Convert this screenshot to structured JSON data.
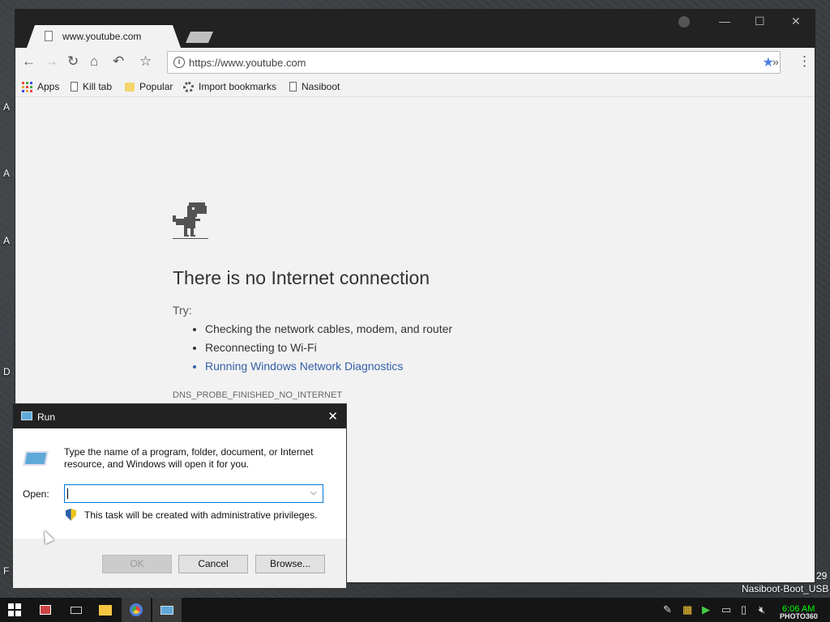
{
  "desktop": {
    "machine_name": "Nasiboot-Boot_USB",
    "partial_number": "29",
    "watermark": "PHOTO360"
  },
  "browser": {
    "tab_title": "www.youtube.com",
    "url": "https://www.youtube.com",
    "bookmarks": [
      {
        "label": "Apps",
        "icon": "apps-grid-icon"
      },
      {
        "label": "Kill tab",
        "icon": "page-icon"
      },
      {
        "label": "Popular",
        "icon": "folder-icon"
      },
      {
        "label": "Import bookmarks",
        "icon": "gear-icon"
      },
      {
        "label": "Nasiboot",
        "icon": "page-icon"
      }
    ]
  },
  "error_page": {
    "heading": "There is no Internet connection",
    "try_label": "Try:",
    "suggestions": [
      "Checking the network cables, modem, and router",
      "Reconnecting to Wi-Fi",
      "Running Windows Network Diagnostics"
    ],
    "error_code": "DNS_PROBE_FINISHED_NO_INTERNET"
  },
  "run_dialog": {
    "title": "Run",
    "description": "Type the name of a program, folder, document, or Internet resource, and Windows will open it for you.",
    "open_label": "Open:",
    "open_value": "",
    "admin_note": "This task will be created with administrative privileges.",
    "ok_label": "OK",
    "cancel_label": "Cancel",
    "browse_label": "Browse..."
  },
  "taskbar": {
    "clock": "6:06 AM"
  },
  "colors": {
    "link": "#335fa8",
    "star": "#4a7fe0",
    "clock": "#00ff00"
  }
}
